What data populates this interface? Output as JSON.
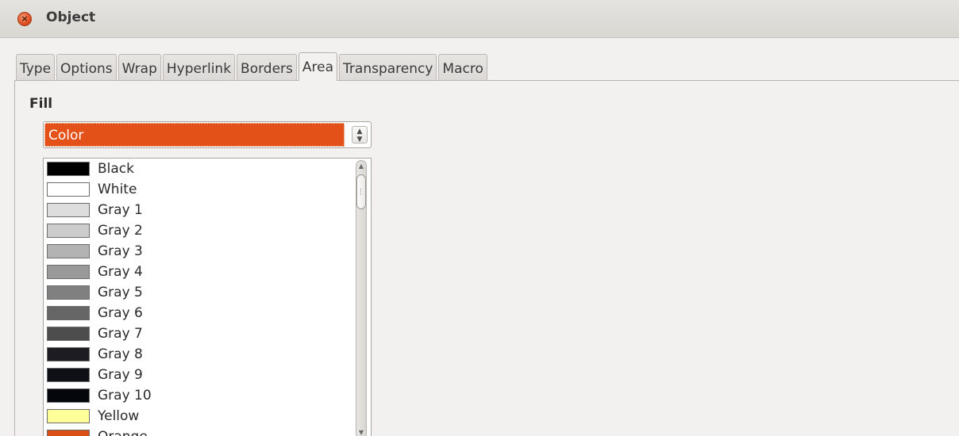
{
  "window": {
    "title": "Object"
  },
  "tabs": [
    {
      "label": "Type"
    },
    {
      "label": "Options"
    },
    {
      "label": "Wrap"
    },
    {
      "label": "Hyperlink"
    },
    {
      "label": "Borders"
    },
    {
      "label": "Area",
      "active": true
    },
    {
      "label": "Transparency"
    },
    {
      "label": "Macro"
    }
  ],
  "area": {
    "fill_label": "Fill",
    "fill_select": {
      "value": "Color",
      "highlight_color": "#e45118"
    },
    "colors": [
      {
        "label": "Black",
        "color": "#000000"
      },
      {
        "label": "White",
        "color": "#ffffff"
      },
      {
        "label": "Gray 1",
        "color": "#dddddd"
      },
      {
        "label": "Gray 2",
        "color": "#cccccc"
      },
      {
        "label": "Gray 3",
        "color": "#b3b3b3"
      },
      {
        "label": "Gray 4",
        "color": "#999999"
      },
      {
        "label": "Gray 5",
        "color": "#808080"
      },
      {
        "label": "Gray 6",
        "color": "#666666"
      },
      {
        "label": "Gray 7",
        "color": "#4d4d4d"
      },
      {
        "label": "Gray 8",
        "color": "#1c1c22"
      },
      {
        "label": "Gray 9",
        "color": "#0f0f17"
      },
      {
        "label": "Gray 10",
        "color": "#05050c"
      },
      {
        "label": "Yellow",
        "color": "#ffff99"
      },
      {
        "label": "Orange",
        "color": "#d94f14"
      }
    ]
  },
  "icons": {
    "close": "close-icon",
    "spin": "spin-arrows-icon",
    "scroll_up": "scroll-up-icon",
    "scroll_down": "scroll-down-icon"
  }
}
